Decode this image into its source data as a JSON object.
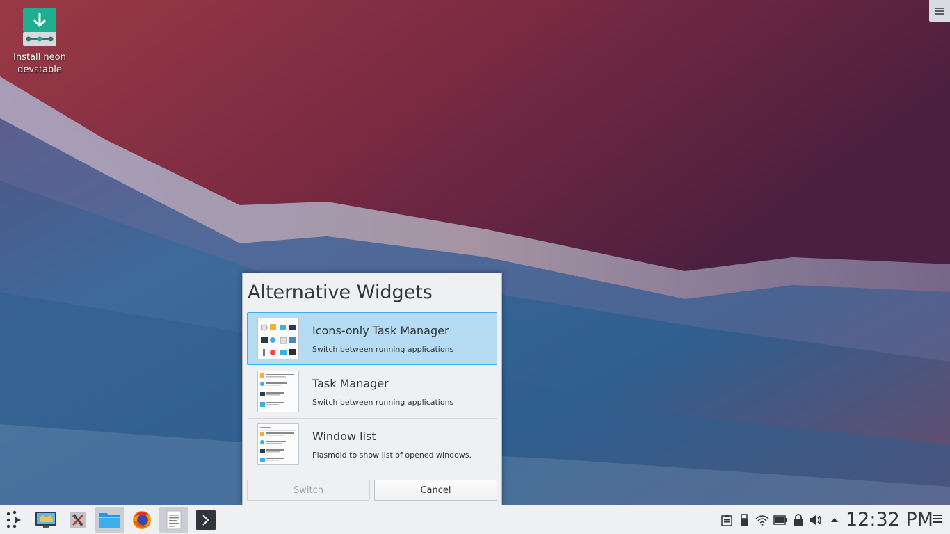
{
  "desktop": {
    "icons": [
      {
        "label": "Install neon devstable",
        "icon": "installer-download-icon"
      }
    ],
    "toolbox_icon": "hamburger-menu-icon"
  },
  "dialog": {
    "title": "Alternative Widgets",
    "items": [
      {
        "name": "Icons-only Task Manager",
        "description": "Switch between running applications",
        "selected": true,
        "icon": "icons-only-taskmanager-thumbnail"
      },
      {
        "name": "Task Manager",
        "description": "Switch between running applications",
        "selected": false,
        "icon": "taskmanager-thumbnail"
      },
      {
        "name": "Window list",
        "description": "Plasmoid to show list of opened windows.",
        "selected": false,
        "icon": "window-list-thumbnail"
      }
    ],
    "buttons": {
      "switch_label": "Switch",
      "cancel_label": "Cancel"
    }
  },
  "panel": {
    "launcher_icon": "kde-launcher-icon",
    "tasks": [
      {
        "icon": "discover-store-icon",
        "active": false
      },
      {
        "icon": "xembed-tools-icon",
        "active": false
      },
      {
        "icon": "dolphin-file-manager-icon",
        "active": true
      },
      {
        "icon": "firefox-icon",
        "active": false
      },
      {
        "icon": "text-editor-icon",
        "active": true
      },
      {
        "icon": "konsole-terminal-icon",
        "active": false
      }
    ],
    "tray": [
      "clipboard-icon",
      "usb-device-icon",
      "wifi-icon",
      "battery-icon",
      "lock-icon",
      "volume-icon",
      "expand-tray-arrow-icon"
    ],
    "clock": "12:32 PM",
    "menu_icon": "panel-options-icon"
  },
  "colors": {
    "accent": "#3daee9",
    "selection": "#b6dcf4",
    "text": "#31363b",
    "panel_bg": "#eff0f1"
  }
}
